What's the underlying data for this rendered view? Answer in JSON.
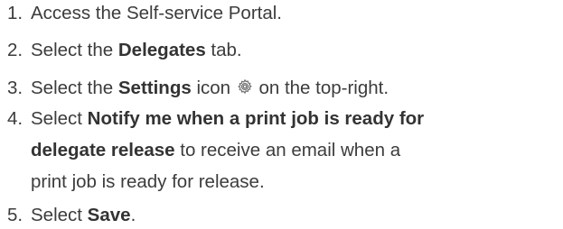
{
  "steps": [
    {
      "number": "1.",
      "text": "Access the Self-service Portal."
    },
    {
      "number": "2.",
      "pre": "Select the ",
      "bold": "Delegates",
      "post": " tab."
    },
    {
      "number": "3.",
      "pre": "Select the ",
      "bold": "Settings",
      "mid": " icon ",
      "icon": "gear-icon",
      "post": " on the top-right."
    },
    {
      "number": "4.",
      "pre": "Select ",
      "bold1": "Notify me when a print job is ready for",
      "bold2": "delegate release",
      "post2": " to receive an email when a",
      "line3": "print job is ready for release."
    },
    {
      "number": "5.",
      "pre": "Select ",
      "bold": "Save",
      "post": "."
    }
  ],
  "colors": {
    "text": "#3c3c3c",
    "icon": "#6e6e6e"
  }
}
